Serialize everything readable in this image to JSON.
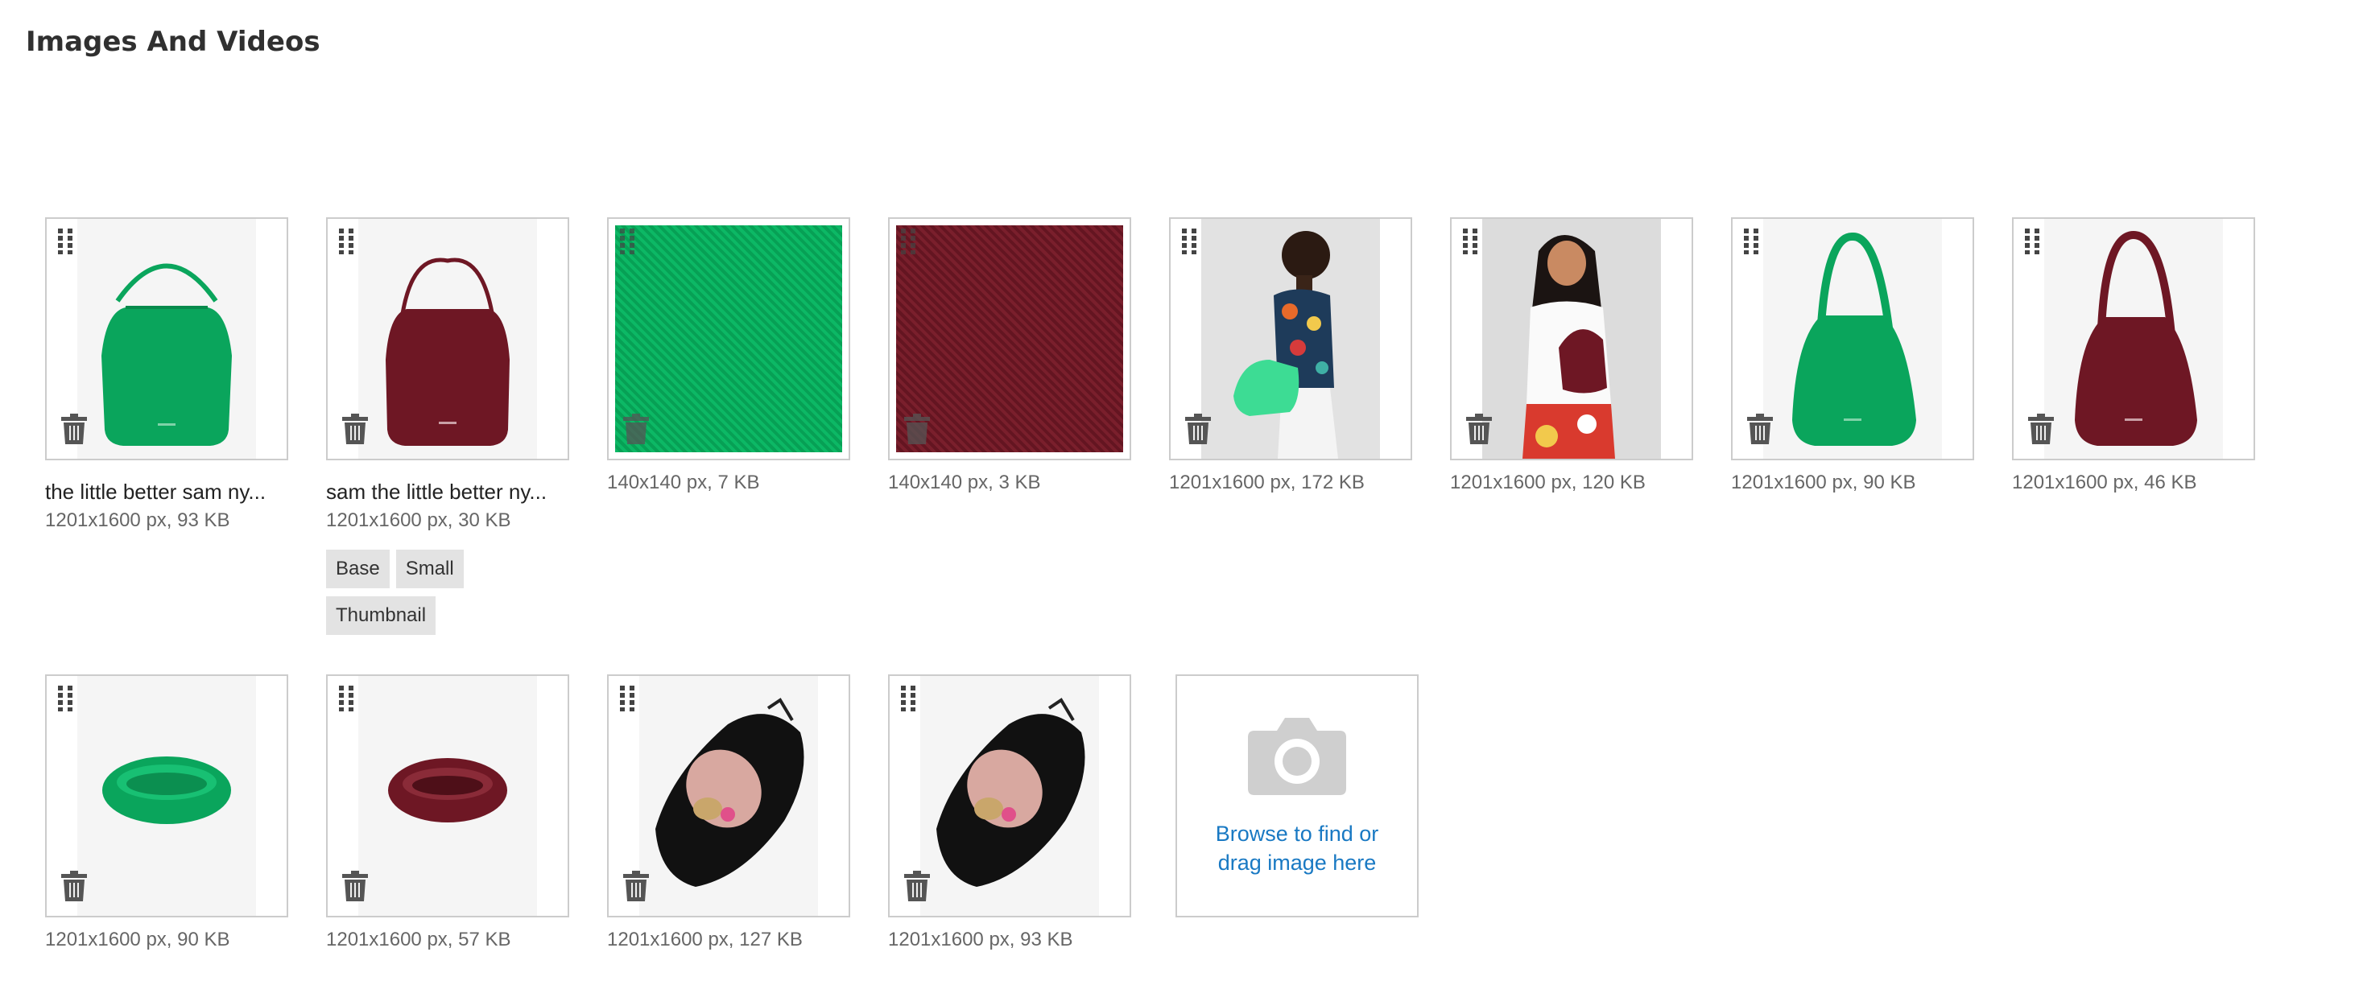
{
  "page": {
    "title": "Images And Videos"
  },
  "images": [
    {
      "name": "the little better sam ny...",
      "meta": "1201x1600 px, 93 KB",
      "roles": []
    },
    {
      "name": "sam the little better ny...",
      "meta": "1201x1600 px, 30 KB",
      "roles": [
        "Base",
        "Small",
        "Thumbnail"
      ]
    },
    {
      "name": "",
      "meta": "140x140 px, 7 KB",
      "roles": []
    },
    {
      "name": "",
      "meta": "140x140 px, 3 KB",
      "roles": []
    },
    {
      "name": "",
      "meta": "1201x1600 px, 172 KB",
      "roles": []
    },
    {
      "name": "",
      "meta": "1201x1600 px, 120 KB",
      "roles": []
    },
    {
      "name": "",
      "meta": "1201x1600 px, 90 KB",
      "roles": []
    },
    {
      "name": "",
      "meta": "1201x1600 px, 46 KB",
      "roles": []
    },
    {
      "name": "",
      "meta": "1201x1600 px, 90 KB",
      "roles": []
    },
    {
      "name": "",
      "meta": "1201x1600 px, 57 KB",
      "roles": []
    },
    {
      "name": "",
      "meta": "1201x1600 px, 127 KB",
      "roles": []
    },
    {
      "name": "",
      "meta": "1201x1600 px, 93 KB",
      "roles": []
    }
  ],
  "uploader": {
    "line1": "Browse to find or",
    "line2": "drag image here"
  },
  "icons": {
    "drag": "drag-handle-icon",
    "delete": "trash-icon",
    "upload": "camera-icon"
  },
  "colors": {
    "green": "#0aa55c",
    "burgundy": "#6e1724",
    "link": "#1979c3",
    "icon": "#4a4a4a"
  }
}
